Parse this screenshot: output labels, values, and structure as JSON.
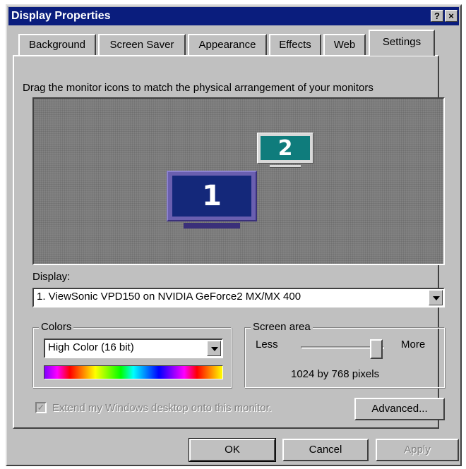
{
  "window": {
    "title": "Display Properties",
    "help_label": "?",
    "close_label": "×"
  },
  "tabs": [
    {
      "label": "Background"
    },
    {
      "label": "Screen Saver"
    },
    {
      "label": "Appearance"
    },
    {
      "label": "Effects"
    },
    {
      "label": "Web"
    },
    {
      "label": "Settings",
      "active": true
    }
  ],
  "settings": {
    "instructions": "Drag the monitor icons to match the physical arrangement of your monitors",
    "monitors": [
      {
        "number": "1",
        "screen_color": "#14287a",
        "frame_color": "#6a5fb0"
      },
      {
        "number": "2",
        "screen_color": "#0f7c7c",
        "frame_color": "#d8d8d8"
      }
    ],
    "display_label": "Display:",
    "display_value": "1. ViewSonic VPD150 on NVIDIA GeForce2 MX/MX 400",
    "colors": {
      "title": "Colors",
      "value": "High Color (16 bit)"
    },
    "screen_area": {
      "title": "Screen area",
      "less_label": "Less",
      "more_label": "More",
      "slider_level": 1.0,
      "resolution_text": "1024 by 768 pixels"
    },
    "extend_desktop": {
      "label": "Extend my Windows desktop onto this monitor.",
      "checked": true,
      "disabled": true
    },
    "advanced_label": "Advanced..."
  },
  "buttons": {
    "ok": "OK",
    "cancel": "Cancel",
    "apply": "Apply"
  },
  "colors": {
    "titlebar": "#0a1d7d",
    "face": "#c0c0c0",
    "monitor_background": "#828282"
  }
}
